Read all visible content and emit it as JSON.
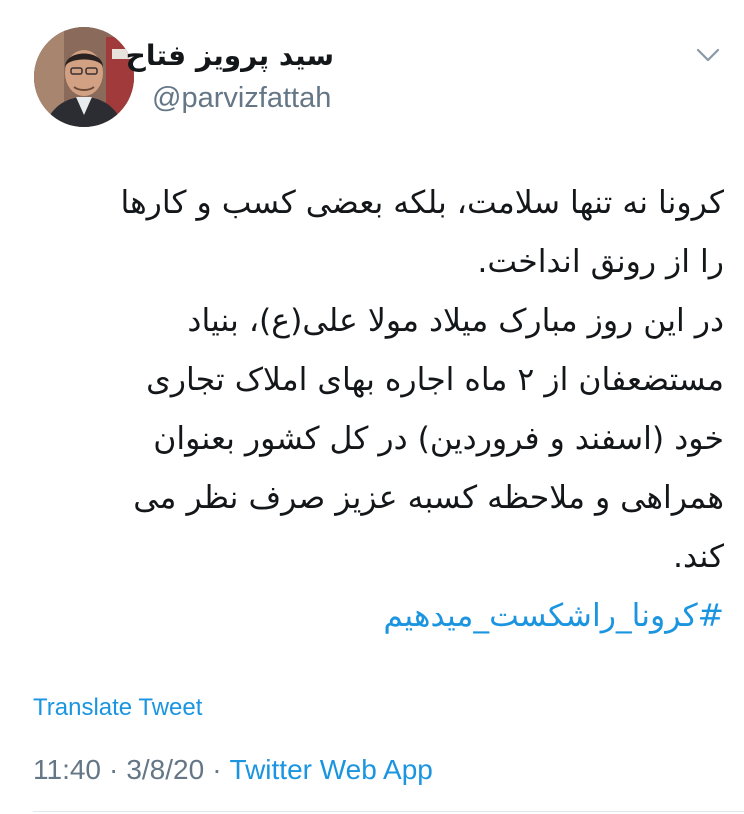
{
  "user": {
    "display_name": "سید پرویز فتاح",
    "handle": "@parvizfattah",
    "avatar_icon": "profile-photo"
  },
  "tweet": {
    "lines": [
      "کرونا نه تنها سلامت، بلکه بعضی کسب و کارها",
      "را از رونق انداخت.",
      "در این روز مبارک میلاد مولا علی(ع)، بنیاد",
      "مستضعفان از ۲ ماه اجاره بهای املاک تجاری",
      "خود (اسفند و فروردین) در کل کشور بعنوان",
      "همراهی و ملاحظه کسبه عزیز صرف نظر می",
      "کند."
    ],
    "hashtag": "#کرونا_راشکست_میدهیم"
  },
  "actions": {
    "translate_label": "Translate Tweet",
    "more_icon": "chevron-down-icon"
  },
  "meta": {
    "time": "11:40",
    "separator": "·",
    "date": "3/8/20",
    "source": "Twitter Web App"
  },
  "colors": {
    "link": "#1b95e0",
    "secondary_text": "#657786",
    "primary_text": "#14171a",
    "divider": "#e1e8ed"
  }
}
